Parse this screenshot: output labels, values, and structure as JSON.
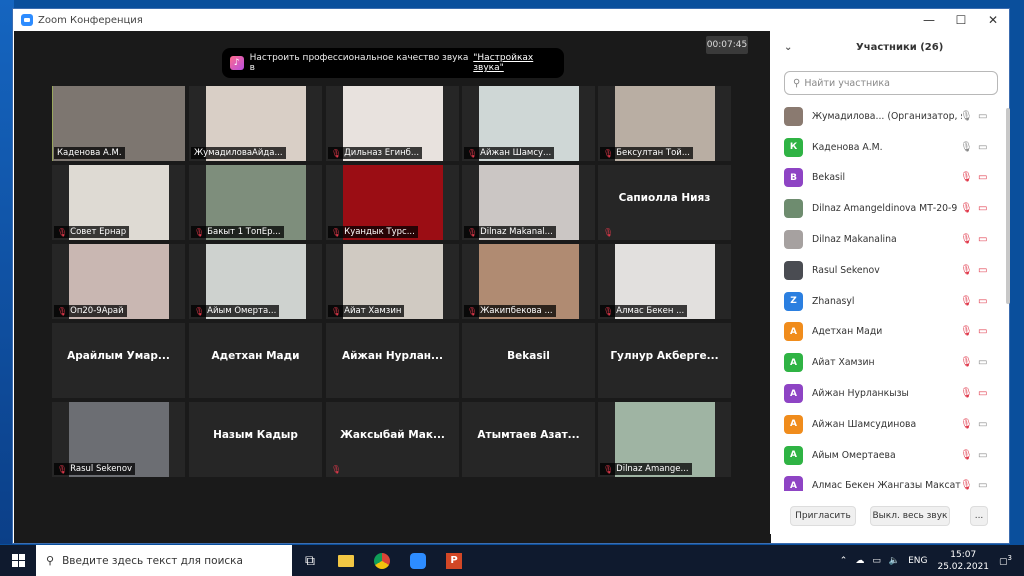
{
  "window": {
    "title": "Zoom Конференция"
  },
  "timer": "00:07:45",
  "notice": {
    "text": "Настроить профессиональное качество звука в",
    "link": "\"Настройках звука\""
  },
  "tiles": [
    {
      "label": "Каденова А.М.",
      "muted": false,
      "active": true,
      "bg": "#c9c4be",
      "photo": "#7d7670"
    },
    {
      "label": "ЖумадиловаАйда...",
      "muted": false,
      "bg": "#262626",
      "photo": "#d9cfc6"
    },
    {
      "label": "Дильназ Егинб...",
      "muted": true,
      "bg": "#262626",
      "photo": "#e8e2de"
    },
    {
      "label": "Айжан Шамсу...",
      "muted": true,
      "bg": "#262626",
      "photo": "#cfd7d6"
    },
    {
      "label": "Бексултан Той...",
      "muted": true,
      "bg": "#262626",
      "photo": "#b9aea3"
    },
    {
      "label": "Совет Ернар",
      "muted": true,
      "bg": "#262626",
      "photo": "#dedad3"
    },
    {
      "label": "Бакыт 1 ТопЕр...",
      "muted": true,
      "bg": "#262626",
      "photo": "#7e8e7c"
    },
    {
      "label": "Куандык Турс...",
      "muted": true,
      "bg": "#262626",
      "photo": "#9b0d14"
    },
    {
      "label": "Dilnaz Makanal...",
      "muted": true,
      "bg": "#262626",
      "photo": "#cbc6c4"
    },
    {
      "name": "Сапиолла Нияз",
      "muted": true
    },
    {
      "label": "Оп20-9Арай",
      "muted": true,
      "bg": "#262626",
      "photo": "#c9b7b2"
    },
    {
      "label": "Айым Омерта...",
      "muted": true,
      "bg": "#262626",
      "photo": "#ced2cf"
    },
    {
      "label": "Айат Хамзин",
      "muted": true,
      "bg": "#262626",
      "photo": "#d0cac2"
    },
    {
      "label": "Жакипбекова ...",
      "muted": true,
      "bg": "#262626",
      "photo": "#b08b72"
    },
    {
      "label": "Алмас Бекен ...",
      "muted": true,
      "bg": "#262626",
      "photo": "#e2e0de"
    },
    {
      "name": "Арайлым Умар...",
      "muted": false
    },
    {
      "name": "Адетхан Мади",
      "muted": false
    },
    {
      "name": "Айжан Нурлан...",
      "muted": false
    },
    {
      "name": "Bekasil",
      "muted": false
    },
    {
      "name": "Гулнур Акберге...",
      "muted": false
    },
    {
      "label": "Rasul Sekenov",
      "muted": true,
      "bg": "#262626",
      "photo": "#6c6e73"
    },
    {
      "name": "Назым Кадыр",
      "muted": false
    },
    {
      "name": "Жаксыбай Мак...",
      "muted": true
    },
    {
      "name": "Атымтаев Азат...",
      "muted": false
    },
    {
      "label": "Dilnaz Amange...",
      "muted": true,
      "bg": "#262626",
      "photo": "#9fb4a3"
    }
  ],
  "panel": {
    "title": "Участники (26)",
    "search_placeholder": "Найти участника",
    "invite": "Пригласить",
    "mute_all": "Выкл. весь звук",
    "more": "..."
  },
  "participants": [
    {
      "initial": "",
      "name": "Жумадилова...  (Организатор, я)",
      "color": "#8a7a70",
      "mic": "on",
      "cam": "on"
    },
    {
      "initial": "К",
      "name": "Каденова А.М.",
      "color": "#2fb344",
      "mic": "on",
      "cam": "on"
    },
    {
      "initial": "B",
      "name": "Bekasil",
      "color": "#8e44c4",
      "mic": "off",
      "cam": "off"
    },
    {
      "initial": "",
      "name": "Dilnaz Amangeldinova МТ-20-9",
      "color": "#6e8c6f",
      "mic": "off",
      "cam": "off"
    },
    {
      "initial": "",
      "name": "Dilnaz Makanalina",
      "color": "#a6a1a0",
      "mic": "off",
      "cam": "off"
    },
    {
      "initial": "",
      "name": "Rasul Sekenov",
      "color": "#4a4c52",
      "mic": "off",
      "cam": "off"
    },
    {
      "initial": "Z",
      "name": "Zhanasyl",
      "color": "#2b7fe0",
      "mic": "off",
      "cam": "off"
    },
    {
      "initial": "А",
      "name": "Адетхан Мади",
      "color": "#f08c1c",
      "mic": "off",
      "cam": "off"
    },
    {
      "initial": "А",
      "name": "Айат Хамзин",
      "color": "#2fb344",
      "mic": "off",
      "cam": "on"
    },
    {
      "initial": "А",
      "name": "Айжан Нурланкызы",
      "color": "#8e44c4",
      "mic": "off",
      "cam": "off"
    },
    {
      "initial": "А",
      "name": "Айжан Шамсудинова",
      "color": "#f08c1c",
      "mic": "off",
      "cam": "on"
    },
    {
      "initial": "А",
      "name": "Айым Омертаева",
      "color": "#2fb344",
      "mic": "off",
      "cam": "on"
    },
    {
      "initial": "А",
      "name": "Алмас Бекен Жангазы Максат",
      "color": "#8e44c4",
      "mic": "off",
      "cam": "on"
    }
  ],
  "taskbar": {
    "search": "Введите здесь текст для поиска",
    "lang": "ENG",
    "time": "15:07",
    "date": "25.02.2021",
    "notif": "3"
  },
  "colors": {
    "muted": "#e0384a",
    "active_border": "#b5d84a"
  }
}
